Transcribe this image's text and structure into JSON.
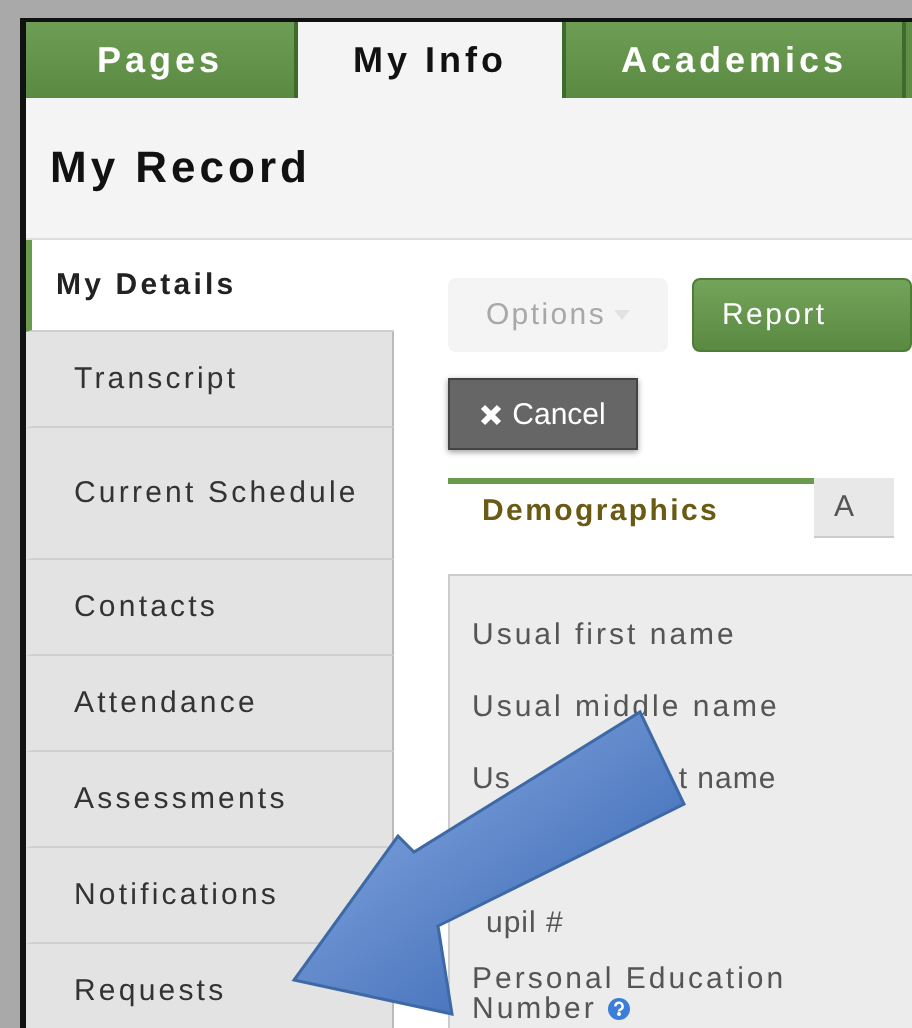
{
  "top_tabs": [
    {
      "label": "Pages",
      "selected": false
    },
    {
      "label": "My Info",
      "selected": true
    },
    {
      "label": "Academics",
      "selected": false
    }
  ],
  "page_title": "My Record",
  "sidebar": {
    "items": [
      {
        "label": "My Details",
        "selected": true
      },
      {
        "label": "Transcript",
        "selected": false
      },
      {
        "label": "Current Schedule",
        "selected": false
      },
      {
        "label": "Contacts",
        "selected": false
      },
      {
        "label": "Attendance",
        "selected": false
      },
      {
        "label": "Assessments",
        "selected": false
      },
      {
        "label": "Notifications",
        "selected": false
      },
      {
        "label": "Requests",
        "selected": false
      }
    ]
  },
  "toolbar": {
    "buttons": [
      {
        "label": "Options",
        "kind": "dropdown",
        "disabled": true
      },
      {
        "label": "Report",
        "kind": "primary",
        "disabled": false
      }
    ],
    "cancel": "Cancel"
  },
  "tabs": [
    {
      "label": "Demographics",
      "selected": true
    },
    {
      "label": "A",
      "selected": false
    }
  ],
  "fields": [
    {
      "kind": "plain",
      "label": "Usual first name"
    },
    {
      "kind": "plain",
      "label": "Usual middle name"
    },
    {
      "kind": "covered",
      "before": "Us",
      "after": "t name"
    },
    {
      "kind": "covered",
      "after": "upil #"
    },
    {
      "kind": "plain",
      "label": "Personal Education Number",
      "help": true
    }
  ]
}
